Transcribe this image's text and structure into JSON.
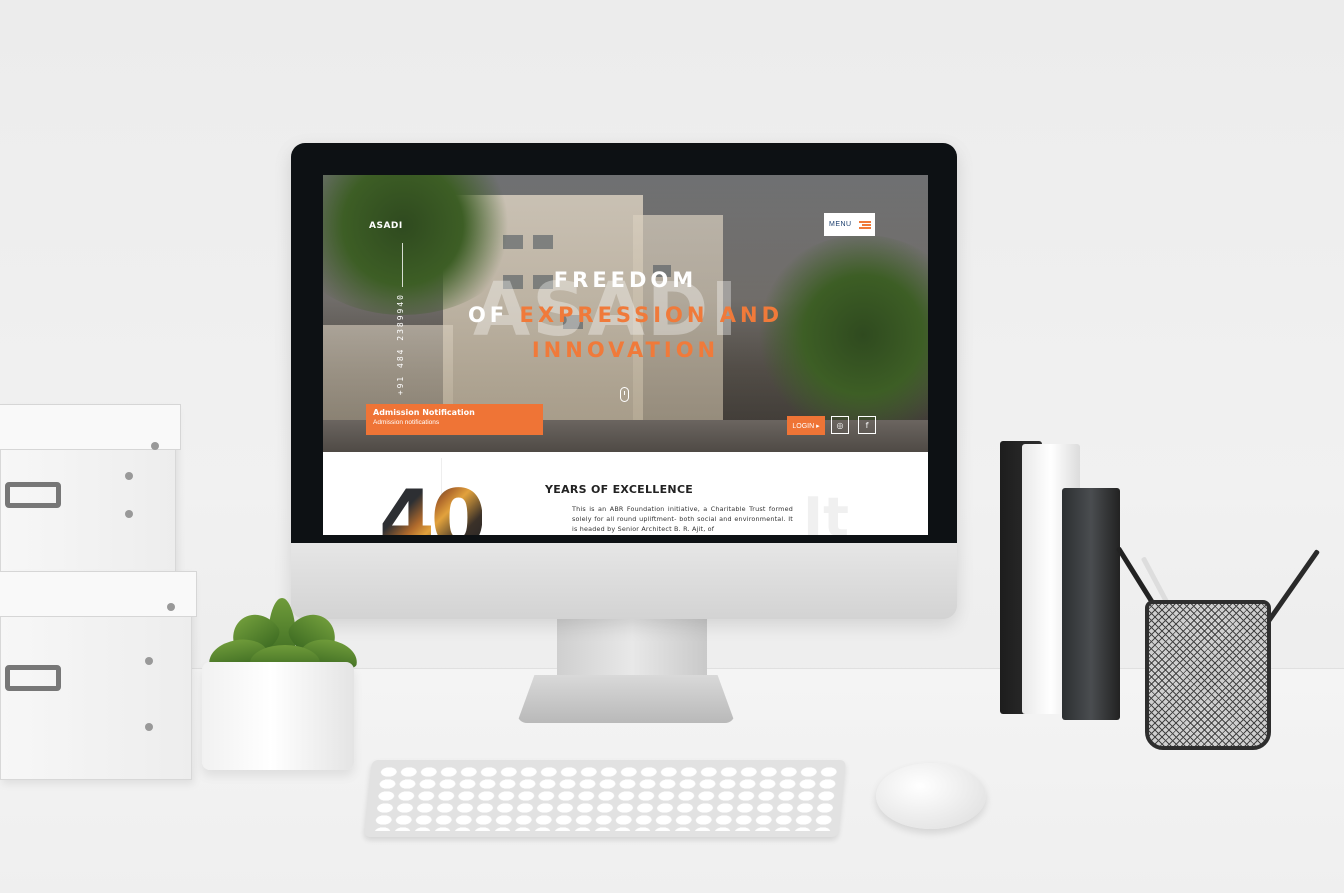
{
  "site": {
    "brand": "ASADI",
    "phone": "+91 484 2389940",
    "menu_label": "MENU",
    "watermark": "ASADI",
    "headline": {
      "line1": "FREEDOM",
      "line2_white": "OF",
      "line2_orange": "EXPRESSION AND",
      "line3": "INNOVATION"
    },
    "notification": {
      "title": "Admission Notification",
      "subtitle": "Admission notifications"
    },
    "login_label": "LOGIN ▸",
    "social": {
      "instagram": "◎",
      "facebook": "f"
    },
    "section": {
      "big_number": "40",
      "ghost_text": "It",
      "heading": "YEARS OF EXCELLENCE",
      "paragraph": "This is an ABR Foundation initiative, a Charitable Trust formed solely for all round upliftment- both social and environmental. It is headed by Senior Architect B. R. Ajit, of"
    }
  },
  "colors": {
    "accent": "#ef7436",
    "menu_text": "#1c3f6e"
  }
}
